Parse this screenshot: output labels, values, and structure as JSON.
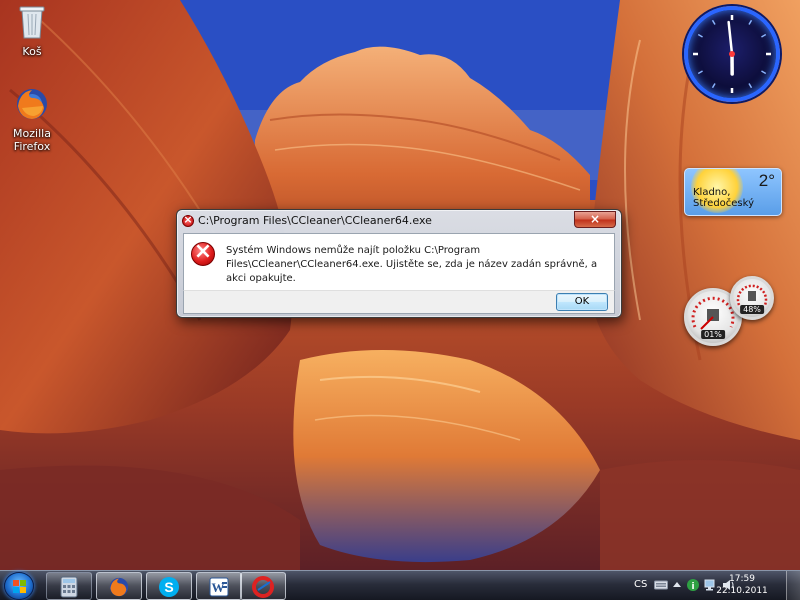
{
  "desktop": {
    "icons": [
      {
        "label": "Koš",
        "icon": "recycle-bin-icon"
      },
      {
        "label": "Mozilla Firefox",
        "icon": "firefox-icon"
      }
    ]
  },
  "gadgets": {
    "clock": {
      "icon": "analog-clock-icon",
      "hour": 5,
      "minute": 59
    },
    "weather": {
      "temperature": "2°",
      "location": "Kladno, Středočeský",
      "icon": "sun-icon"
    },
    "cpu_meter": {
      "cpu": "01%",
      "ram": "48%",
      "icon": "cpu-meter-icon"
    }
  },
  "dialog": {
    "title": "C:\\Program Files\\CCleaner\\CCleaner64.exe",
    "close_label": "×",
    "message": "Systém Windows nemůže najít položku C:\\Program Files\\CCleaner\\CCleaner64.exe. Ujistěte se, zda je název zadán správně, a akci opakujte.",
    "ok_label": "OK",
    "icon": "error-icon"
  },
  "taskbar": {
    "start_icon": "windows-logo-icon",
    "buttons": [
      {
        "name": "calculator",
        "icon": "calculator-icon"
      },
      {
        "name": "firefox",
        "icon": "firefox-icon"
      },
      {
        "name": "skype",
        "icon": "skype-icon"
      },
      {
        "name": "word",
        "icon": "word-icon"
      },
      {
        "name": "ccleaner",
        "icon": "ccleaner-icon"
      }
    ],
    "tray": {
      "language": "CS",
      "time": "17:59",
      "date": "22.10.2011"
    }
  },
  "colors": {
    "error_red": "#d81e1e",
    "taskbar_dark": "#1a1f2c",
    "ok_border": "#3c7fb1"
  }
}
